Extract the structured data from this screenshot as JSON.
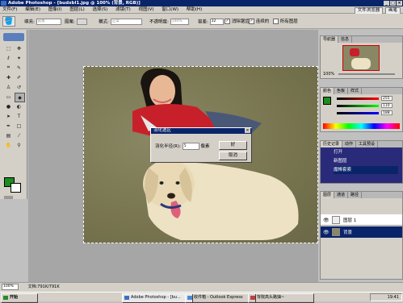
{
  "window": {
    "title": "Adobe Photoshop - [budxbl1.jpg @ 100% (背景, RGB)]"
  },
  "menu": {
    "items": [
      "文件(F)",
      "编辑(E)",
      "图像(I)",
      "图层(L)",
      "选择(S)",
      "滤镜(T)",
      "视图(V)",
      "窗口(W)",
      "帮助(H)"
    ],
    "right_tabs": [
      "文件浏览器",
      "画笔"
    ]
  },
  "options": {
    "fill_label": "填充:",
    "fill_value": "前景",
    "pattern_label": "图案:",
    "mode_label": "模式:",
    "mode_value": "正常",
    "opacity_label": "不透明度:",
    "opacity_value": "100%",
    "tolerance_label": "容差:",
    "tolerance_value": "32",
    "antialias_label": "消除锯齿",
    "contiguous_label": "连续的",
    "all_layers_label": "所有图层"
  },
  "dialog": {
    "title": "羽化选区",
    "radius_label": "羽化半径(R):",
    "radius_value": "5",
    "unit": "像素",
    "ok": "好",
    "cancel": "取消"
  },
  "navigator": {
    "tabs": [
      "导航器",
      "信息"
    ],
    "zoom": "100%"
  },
  "color_panel": {
    "tabs": [
      "颜色",
      "色板",
      "样式"
    ],
    "values": [
      "255",
      "110",
      "188"
    ],
    "fg_color": "#1e8c1e"
  },
  "history": {
    "tabs": [
      "历史记录",
      "动作",
      "工具预设"
    ],
    "items": [
      "打开",
      "新图层",
      "魔棒套索"
    ]
  },
  "layers": {
    "tabs": [
      "图层",
      "通道",
      "路径"
    ],
    "items": [
      "图层 1",
      "背景"
    ]
  },
  "status": {
    "zoom": "100%",
    "doc": "文档:791K/791K"
  },
  "taskbar": {
    "start": "开始",
    "tasks": [
      "Adobe Photoshop - [bu...",
      "收件箱 - Outlook Express",
      "背院高头路抽~"
    ],
    "clock": "19:41"
  },
  "colors": {
    "titlebar": "#0a246a",
    "fg_swatch": "#1e8c1e"
  }
}
